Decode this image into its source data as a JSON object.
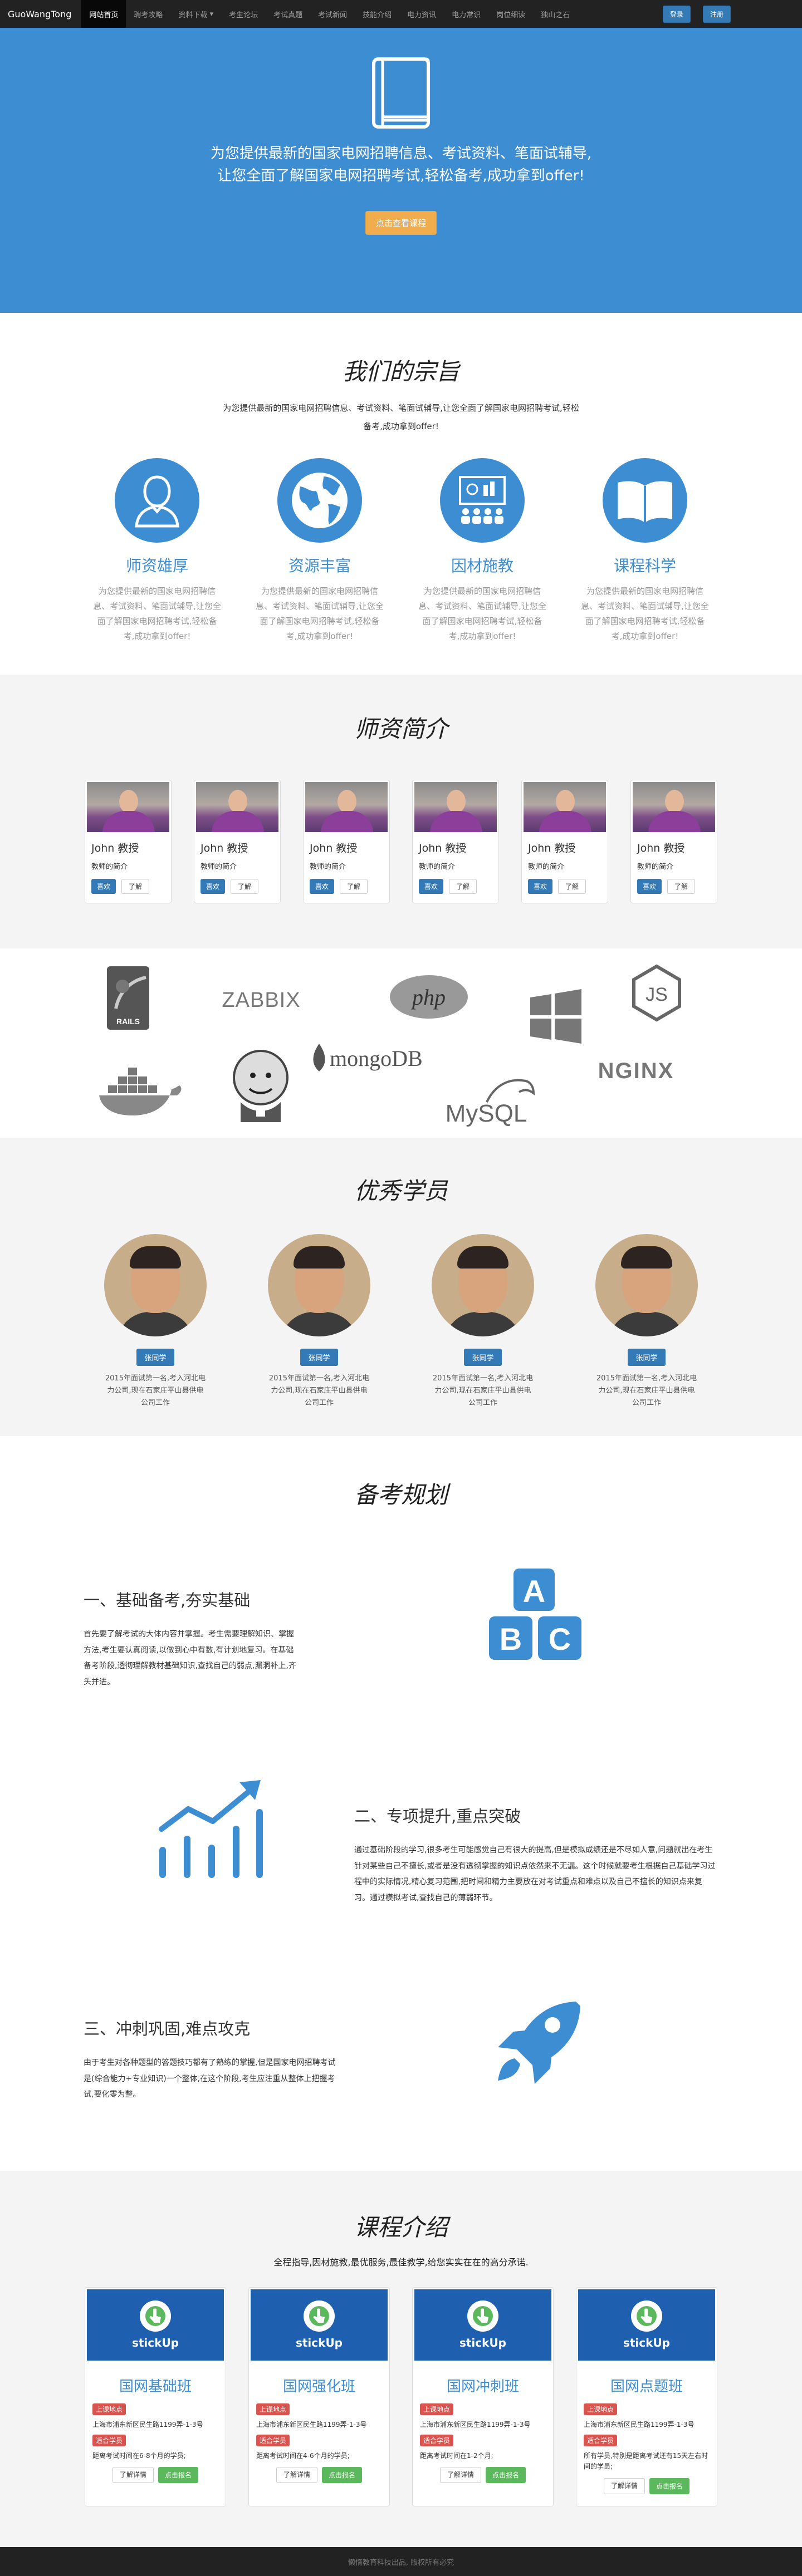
{
  "nav": {
    "brand": "GuoWangTong",
    "items": [
      "网站首页",
      "聘考攻略",
      "资料下载",
      "考生论坛",
      "考试真题",
      "考试新闻",
      "技能介绍",
      "电力资讯",
      "电力常识",
      "岗位细读",
      "独山之石"
    ],
    "dropdown_caret": "▾",
    "login": "登录",
    "register": "注册"
  },
  "hero": {
    "line1": "为您提供最新的国家电网招聘信息、考试资料、笔面试辅导,",
    "line2": "让您全面了解国家电网招聘考试,轻松备考,成功拿到offer!",
    "button": "点击查看课程"
  },
  "purpose": {
    "title": "我们的宗旨",
    "subtitle": "为您提供最新的国家电网招聘信息、考试资料、笔面试辅导,让您全面了解国家电网招聘考试,轻松备考,成功拿到offer!",
    "features": [
      {
        "icon": "teacher-user-icon",
        "title": "师资雄厚",
        "desc": "为您提供最新的国家电网招聘信息、考试资料、笔面试辅导,让您全面了解国家电网招聘考试,轻松备考,成功拿到offer!"
      },
      {
        "icon": "globe-icon",
        "title": "资源丰富",
        "desc": "为您提供最新的国家电网招聘信息、考试资料、笔面试辅导,让您全面了解国家电网招聘考试,轻松备考,成功拿到offer!"
      },
      {
        "icon": "presentation-icon",
        "title": "因材施教",
        "desc": "为您提供最新的国家电网招聘信息、考试资料、笔面试辅导,让您全面了解国家电网招聘考试,轻松备考,成功拿到offer!"
      },
      {
        "icon": "open-book-icon",
        "title": "课程科学",
        "desc": "为您提供最新的国家电网招聘信息、考试资料、笔面试辅导,让您全面了解国家电网招聘考试,轻松备考,成功拿到offer!"
      }
    ]
  },
  "teachers": {
    "title": "师资简介",
    "cards": [
      {
        "name": "John 教授",
        "intro": "教师的简介",
        "like": "喜欢",
        "more": "了解"
      },
      {
        "name": "John 教授",
        "intro": "教师的简介",
        "like": "喜欢",
        "more": "了解"
      },
      {
        "name": "John 教授",
        "intro": "教师的简介",
        "like": "喜欢",
        "more": "了解"
      },
      {
        "name": "John 教授",
        "intro": "教师的简介",
        "like": "喜欢",
        "more": "了解"
      },
      {
        "name": "John 教授",
        "intro": "教师的简介",
        "like": "喜欢",
        "more": "了解"
      },
      {
        "name": "John 教授",
        "intro": "教师的简介",
        "like": "喜欢",
        "more": "了解"
      }
    ]
  },
  "logos": {
    "rails": "RAILS",
    "zabbix": "ZABBIX",
    "php": "php",
    "windows": "windows-logo",
    "nodejs": "JS",
    "docker": "docker-logo",
    "jenkins": "jenkins-logo",
    "mongodb": "mongoDB",
    "mysql": "MySQL",
    "nginx": "NGINX"
  },
  "students": {
    "title": "优秀学员",
    "items": [
      {
        "name": "张同学",
        "desc": "2015年面试第一名,考入河北电力公司,现在石家庄平山县供电公司工作"
      },
      {
        "name": "张同学",
        "desc": "2015年面试第一名,考入河北电力公司,现在石家庄平山县供电公司工作"
      },
      {
        "name": "张同学",
        "desc": "2015年面试第一名,考入河北电力公司,现在石家庄平山县供电公司工作"
      },
      {
        "name": "张同学",
        "desc": "2015年面试第一名,考入河北电力公司,现在石家庄平山县供电公司工作"
      }
    ]
  },
  "plan": {
    "title": "备考规划",
    "steps": [
      {
        "heading": "一、基础备考,夯实基础",
        "text": "首先要了解考试的大体内容并掌握。考生需要理解知识、掌握方法,考生要认真阅读,以做到心中有数,有计划地复习。在基础备考阶段,透彻理解教材基础知识,查找自己的弱点,漏洞补上,齐头并进。",
        "icon": "abc-blocks-icon"
      },
      {
        "heading": "二、专项提升,重点突破",
        "text": "通过基础阶段的学习,很多考生可能感觉自己有很大的提高,但是模拟成绩还是不尽如人意,问题就出在考生针对某些自己不擅长,或者是没有透彻掌握的知识点依然来不无漏。这个时候就要考生根据自己基础学习过程中的实际情况,精心复习范围,把时间和精力主要放在对考试重点和难点以及自己不擅长的知识点来复习。通过模拟考试,查找自己的薄弱环节。",
        "icon": "growth-chart-icon"
      },
      {
        "heading": "三、冲刺巩固,难点攻克",
        "text": "由于考生对各种题型的答题技巧都有了熟练的掌握,但是国家电网招聘考试是(综合能力+专业知识)一个整体,在这个阶段,考生应注重从整体上把握考试,要化零为整。",
        "icon": "rocket-icon"
      }
    ]
  },
  "courses": {
    "title": "课程介绍",
    "subtitle": "全程指导,因材施教,最优服务,最佳教学,给您实实在在的高分承诺.",
    "banner_text": "stickUp",
    "cards": [
      {
        "name": "国网基础班",
        "tag1": "上课地点",
        "addr": "上海市浦东新区民生路1199弄-1-3号",
        "tag2": "适合学员",
        "fit": "距离考试时间在6-8个月的学员;",
        "more": "了解详情",
        "signup": "点击报名"
      },
      {
        "name": "国网强化班",
        "tag1": "上课地点",
        "addr": "上海市浦东新区民生路1199弄-1-3号",
        "tag2": "适合学员",
        "fit": "距离考试时间在4-6个月的学员;",
        "more": "了解详情",
        "signup": "点击报名"
      },
      {
        "name": "国网冲刺班",
        "tag1": "上课地点",
        "addr": "上海市浦东新区民生路1199弄-1-3号",
        "tag2": "适合学员",
        "fit": "距离考试时间在1-2个月;",
        "more": "了解详情",
        "signup": "点击报名"
      },
      {
        "name": "国网点题班",
        "tag1": "上课地点",
        "addr": "上海市浦东新区民生路1199弄-1-3号",
        "tag2": "适合学员",
        "fit": "所有学员,特别是距离考试还有15天左右时间的学员;",
        "more": "了解详情",
        "signup": "点击报名"
      }
    ]
  },
  "footer": {
    "text": "懒惰教育科技出品, 版权所有必究"
  },
  "colors": {
    "primary": "#3d8dd2",
    "navbar": "#222222",
    "orange": "#f0ad4e",
    "red": "#d9534f",
    "green": "#5cb85c",
    "bg_gray": "#f4f4f4"
  }
}
